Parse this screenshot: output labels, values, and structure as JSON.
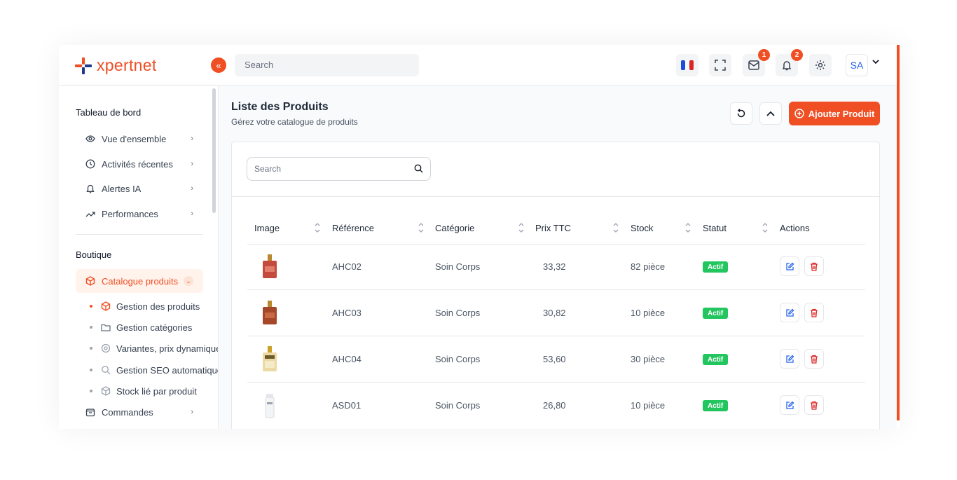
{
  "colors": {
    "accent": "#f04e23",
    "blue": "#2563eb",
    "status_green": "#22c55e"
  },
  "brand": {
    "name": "xpertnet"
  },
  "topbar": {
    "search_placeholder": "Search",
    "mail_count": "1",
    "notif_count": "2",
    "user_initials": "SA",
    "icons": [
      "french-flag-icon",
      "fullscreen-icon",
      "mail-icon",
      "bell-icon",
      "gear-icon",
      "chevron-down-icon"
    ]
  },
  "sidebar": {
    "section_dashboard": "Tableau de bord",
    "dashboard_items": [
      {
        "label": "Vue d'ensemble",
        "icon": "eye-icon"
      },
      {
        "label": "Activités récentes",
        "icon": "clock-icon"
      },
      {
        "label": "Alertes IA",
        "icon": "bell-icon"
      },
      {
        "label": "Performances",
        "icon": "trend-up-icon"
      }
    ],
    "section_shop": "Boutique",
    "catalog": {
      "label": "Catalogue produits",
      "icon": "box-icon"
    },
    "catalog_sub": [
      {
        "label": "Gestion des produits",
        "icon": "box-icon"
      },
      {
        "label": "Gestion catégories",
        "icon": "folder-icon"
      },
      {
        "label": "Variantes, prix dynamiques",
        "icon": "gear-icon"
      },
      {
        "label": "Gestion SEO automatique",
        "icon": "search-icon"
      },
      {
        "label": "Stock lié par produit",
        "icon": "package-icon"
      }
    ],
    "orders": {
      "label": "Commandes",
      "icon": "shopping-bag-icon"
    }
  },
  "page": {
    "title": "Liste des Produits",
    "subtitle": "Gérez votre catalogue de produits",
    "add_button": "Ajouter Produit"
  },
  "table": {
    "search_placeholder": "Search",
    "columns": [
      "Image",
      "Référence",
      "Catégorie",
      "Prix TTC",
      "Stock",
      "Statut",
      "Actions"
    ],
    "rows": [
      {
        "ref": "AHC02",
        "category": "Soin Corps",
        "price": "33,32",
        "stock": "82 pièce",
        "status": "Actif"
      },
      {
        "ref": "AHC03",
        "category": "Soin Corps",
        "price": "30,82",
        "stock": "10 pièce",
        "status": "Actif"
      },
      {
        "ref": "AHC04",
        "category": "Soin Corps",
        "price": "53,60",
        "stock": "30 pièce",
        "status": "Actif"
      },
      {
        "ref": "ASD01",
        "category": "Soin Corps",
        "price": "26,80",
        "stock": "10 pièce",
        "status": "Actif"
      }
    ]
  }
}
